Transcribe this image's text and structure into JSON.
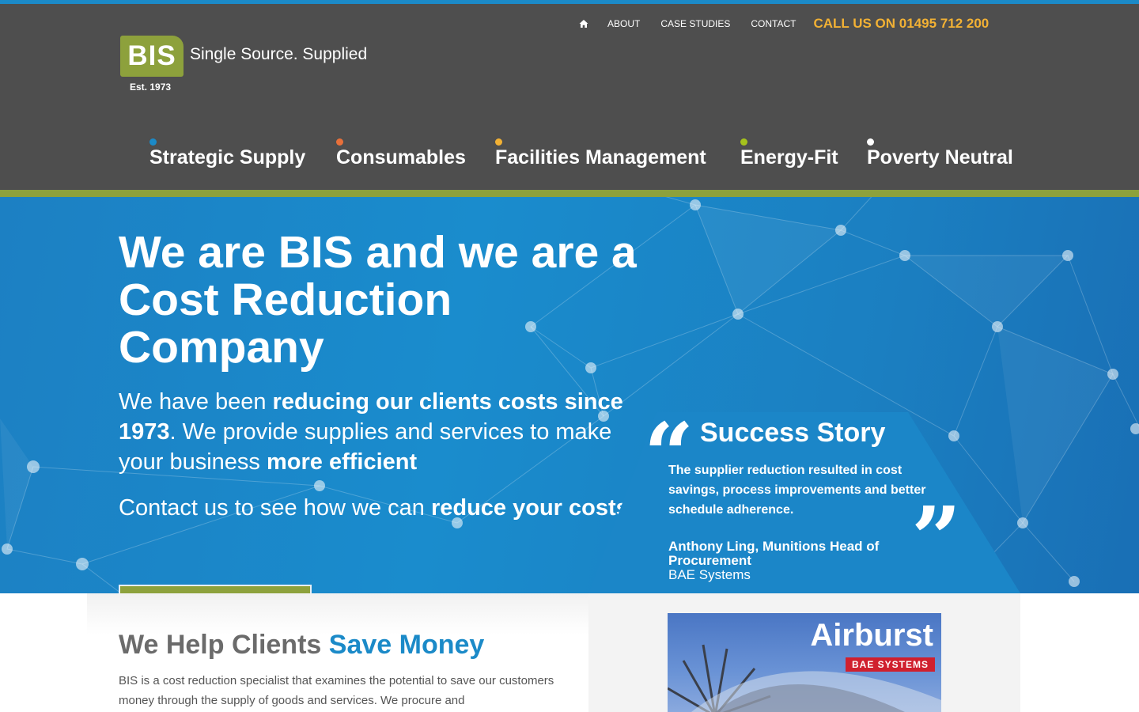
{
  "header": {
    "logo": {
      "mark": "BIS",
      "tagline": "Single Source. Supplied",
      "established": "Est. 1973"
    },
    "top_nav": {
      "home_icon": "home-icon",
      "links": [
        "ABOUT",
        "CASE STUDIES",
        "CONTACT"
      ],
      "call": "CALL US ON 01495 712 200"
    },
    "main_nav": [
      {
        "label": "Strategic Supply",
        "dot_color": "#1b8ac8"
      },
      {
        "label": "Consumables",
        "dot_color": "#e8703a"
      },
      {
        "label": "Facilities Management",
        "dot_color": "#f2b134"
      },
      {
        "label": "Energy-Fit",
        "dot_color": "#a5c21c"
      },
      {
        "label": "Poverty Neutral",
        "dot_color": "#ffffff"
      }
    ]
  },
  "hero": {
    "title": "We are BIS and we are a Cost Reduction Company",
    "p1": [
      "We have been ",
      "reducing our clients costs since 1973",
      ". We provide supplies and services to make your business ",
      "more efficient"
    ],
    "p2": [
      "Contact us to see how we can ",
      "reduce your costs"
    ]
  },
  "success_story": {
    "title": "Success Story",
    "quote": "The supplier reduction resulted in cost savings, process improvements and better schedule adherence.",
    "author": "Anthony Ling, Munitions Head of Procurement",
    "company": "BAE Systems",
    "open_quote": "“",
    "close_quote": "”"
  },
  "help": {
    "title_grey": "We Help Clients",
    "title_blue": "Save Money",
    "text": "BIS is a cost reduction specialist that examines the potential to save our customers money through the supply of goods and services. We procure and"
  },
  "case_image": {
    "title": "Airburst",
    "badge": "BAE SYSTEMS"
  },
  "colors": {
    "header_bg": "#4e4e4e",
    "accent_green": "#8da13c",
    "accent_blue": "#1b8ac8",
    "call_orange": "#f2b134"
  }
}
